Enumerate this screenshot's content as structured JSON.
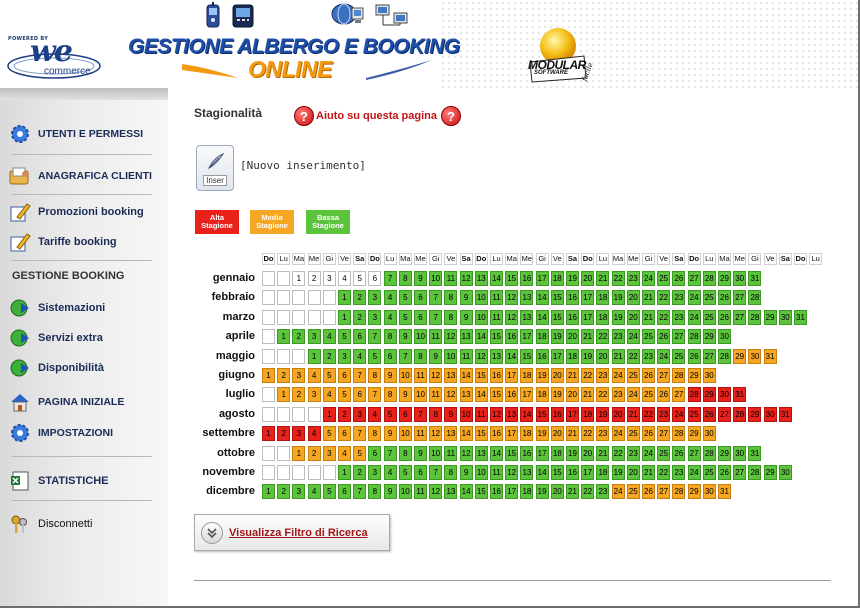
{
  "header": {
    "powered_by": "POWERED BY",
    "we_logo": "we",
    "we_logo_sub": "commerce",
    "title_line1": "GESTIONE ALBERGO E BOOKING",
    "title_line2": "ONLINE",
    "partner_logo": "MODULAR",
    "partner_logo_sub": "SOFTWARE",
    "partner_logo_tag": "facile"
  },
  "sidebar": {
    "items": [
      {
        "label": "UTENTI E PERMESSI",
        "icon": "users-gear-icon"
      },
      {
        "label": "ANAGRAFICA CLIENTI",
        "icon": "client-folder-icon"
      },
      {
        "label": "Promozioni booking",
        "icon": "edit-pencil-icon"
      },
      {
        "label": "Tariffe booking",
        "icon": "edit-pencil-icon"
      }
    ],
    "section_title": "GESTIONE BOOKING",
    "booking_items": [
      {
        "label": "Sistemazioni",
        "icon": "globe-arrow-icon"
      },
      {
        "label": "Servizi extra",
        "icon": "globe-arrow-icon"
      },
      {
        "label": "Disponibilità",
        "icon": "globe-arrow-icon"
      },
      {
        "label": "PAGINA INIZIALE",
        "icon": "home-icon"
      },
      {
        "label": "IMPOSTAZIONI",
        "icon": "settings-gear-icon"
      },
      {
        "label": "STATISTICHE",
        "icon": "excel-sheet-icon"
      },
      {
        "label": "Disconnetti",
        "icon": "keys-icon"
      }
    ]
  },
  "main": {
    "page_title": "Stagionalità",
    "help_text": "Aiuto su questa pagina",
    "help_icon": "?",
    "new_button_label": "Inser",
    "new_link": "[Nuovo inserimento]",
    "legend": [
      {
        "label_1": "Alta",
        "label_2": "Stagione",
        "color": "#e8221b"
      },
      {
        "label_1": "Media",
        "label_2": "Stagione",
        "color": "#f5a623"
      },
      {
        "label_1": "Bassa",
        "label_2": "Stagione",
        "color": "#5cc33d"
      }
    ],
    "weekday_header": [
      "Do",
      "Lu",
      "Ma",
      "Me",
      "Gi",
      "Ve",
      "Sa",
      "Do",
      "Lu",
      "Ma",
      "Me",
      "Gi",
      "Ve",
      "Sa",
      "Do",
      "Lu",
      "Ma",
      "Me",
      "Gi",
      "Ve",
      "Sa",
      "Do",
      "Lu",
      "Ma",
      "Me",
      "Gi",
      "Ve",
      "Sa",
      "Do",
      "Lu",
      "Ma",
      "Me",
      "Gi",
      "Ve",
      "Sa",
      "Do",
      "Lu"
    ],
    "months": [
      {
        "name": "gennaio",
        "offset": 2,
        "days": 31,
        "seasons": "WWWWWWGGGGGGGGGGGGGGGGGGGGGGGGG"
      },
      {
        "name": "febbraio",
        "offset": 5,
        "days": 28,
        "seasons": "GGGGGGGGGGGGGGGGGGGGGGGGGGGG"
      },
      {
        "name": "marzo",
        "offset": 5,
        "days": 31,
        "seasons": "GGGGGGGGGGGGGGGGGGGGGGGGGGGGGGG"
      },
      {
        "name": "aprile",
        "offset": 1,
        "days": 30,
        "seasons": "GGGGGGGGGGGGGGGGGGGGGGGGGGGGGG"
      },
      {
        "name": "maggio",
        "offset": 3,
        "days": 31,
        "seasons": "GGGGGGGGGGGGGGGGGGGGGGGGGGGGOOO"
      },
      {
        "name": "giugno",
        "offset": 0,
        "days": 30,
        "seasons": "OOOOOOOOOOOOOOOOOOOOOOOOOOOOOO"
      },
      {
        "name": "luglio",
        "offset": 1,
        "days": 31,
        "seasons": "OOOOOOOOOOOOOOOOOOOOOOOOOOORRRR"
      },
      {
        "name": "agosto",
        "offset": 4,
        "days": 31,
        "seasons": "RRRRRRRRRRRRRRRRRRRRRRRRRRRRRRR"
      },
      {
        "name": "settembre",
        "offset": 0,
        "days": 30,
        "seasons": "RRRROOOOOOOOOOOOOOOOOOOOOOOOOO"
      },
      {
        "name": "ottobre",
        "offset": 2,
        "days": 31,
        "seasons": "OOOOOGGGGGGGGGGGGGGGGGGGGGGGGGG"
      },
      {
        "name": "novembre",
        "offset": 5,
        "days": 30,
        "seasons": "GGGGGGGGGGGGGGGGGGGGGGGGGGGGGG"
      },
      {
        "name": "dicembre",
        "offset": 0,
        "days": 31,
        "seasons": "GGGGGGGGGGGGGGGGGGGGGGGOOOOOOOO"
      }
    ],
    "filter_button": "Visualizza Filtro di Ricerca",
    "filter_icon": "double-chevron-down-icon"
  }
}
